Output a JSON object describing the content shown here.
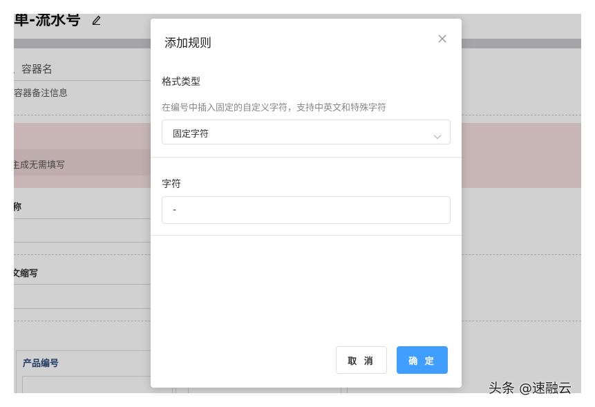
{
  "background": {
    "page_title": "単-流水号",
    "container_name_label": "、容器名",
    "container_note_label": "容器备注信息",
    "auto_generate_text": "主成无需填写",
    "name_label": "称",
    "abbr_label": "文缩写",
    "product_code_header": "产品编号"
  },
  "modal": {
    "title": "添加规则",
    "format_type_label": "格式类型",
    "format_hint": "在编号中插入固定的自定义字符，支持中英文和特殊字符",
    "format_type_value": "固定字符",
    "char_label": "字符",
    "char_value": "-",
    "cancel_label": "取 消",
    "ok_label": "确 定"
  },
  "watermark": "头条 @速融云",
  "colors": {
    "primary": "#409eff",
    "overlay": "rgba(0,0,0,0.18)",
    "highlight_bg": "#f3dedd"
  },
  "icons": {
    "title_edit": "pencil-icon",
    "close": "close-icon",
    "select_caret": "chevron-down-icon"
  }
}
